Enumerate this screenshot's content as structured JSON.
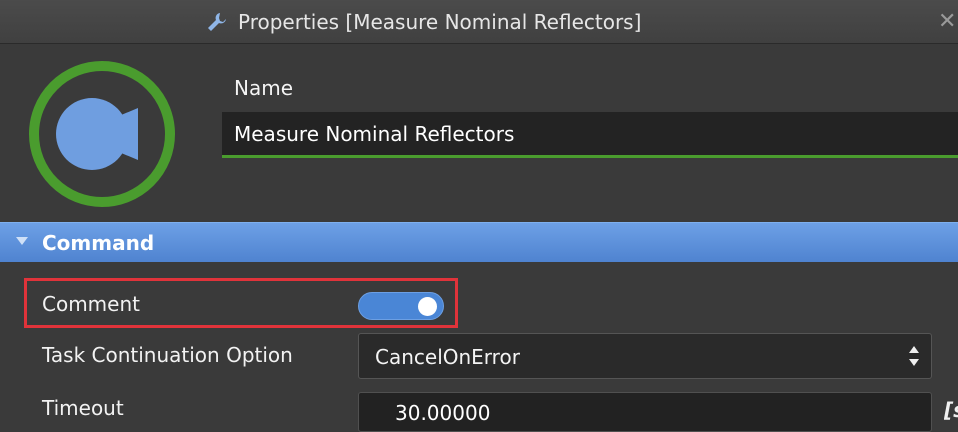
{
  "titlebar": {
    "title": "Properties [Measure Nominal Reflectors]",
    "icon": "wrench-icon",
    "close_glyph": "✕"
  },
  "header": {
    "name_label": "Name",
    "name_value": "Measure Nominal Reflectors",
    "avatar_icon": "camera-icon"
  },
  "section": {
    "label": "Command"
  },
  "fields": {
    "comment_label": "Comment",
    "comment_enabled": true,
    "task_continuation_label": "Task Continuation Option",
    "task_continuation_value": "CancelOnError",
    "timeout_label": "Timeout",
    "timeout_value": "30.00000",
    "timeout_unit": "[s"
  },
  "colors": {
    "accent_green": "#4a9c2e",
    "section_blue": "#5a8fd9",
    "toggle_blue": "#4a86d6",
    "highlight_red": "#e0333a"
  }
}
